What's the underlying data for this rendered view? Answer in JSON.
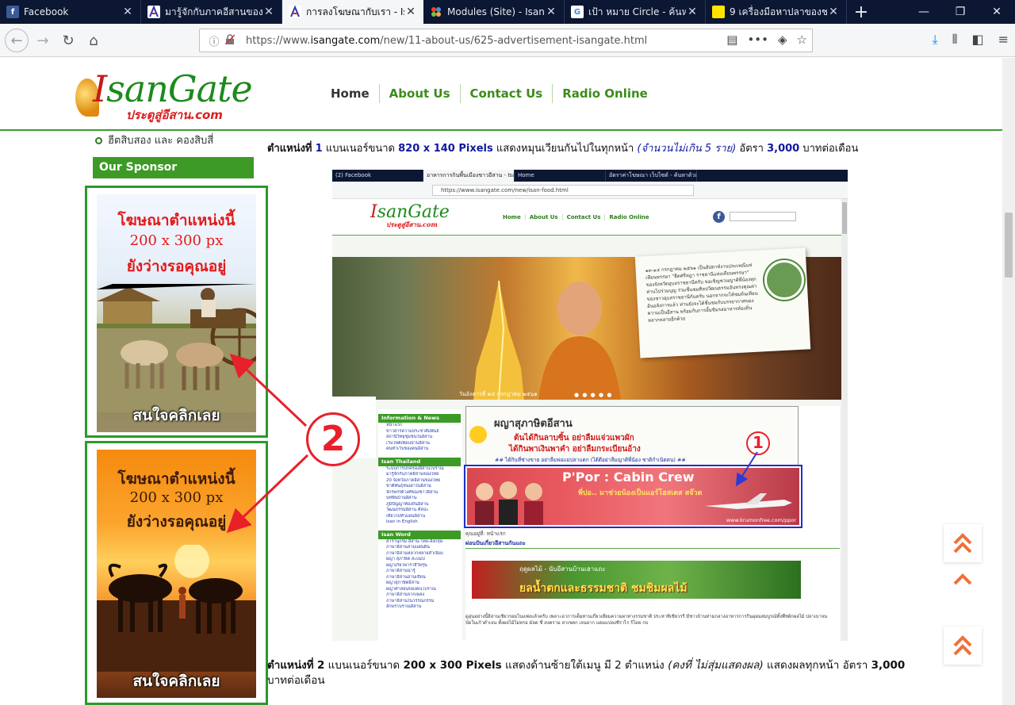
{
  "browser": {
    "tabs": [
      {
        "label": "Facebook",
        "icon": "facebook-icon",
        "active": false
      },
      {
        "label": "มารู้จักกับภาคอีสานของไทย",
        "icon": "isangate-icon",
        "active": false
      },
      {
        "label": "การลงโฆษณากับเรา - IsanGate",
        "icon": "isangate-icon",
        "active": true
      },
      {
        "label": "Modules (Site) - IsanGate",
        "icon": "joomla-icon",
        "active": false
      },
      {
        "label": "เป้า หมาย Circle - ค้นหาด้วย Google",
        "icon": "google-icon",
        "active": false
      },
      {
        "label": "9 เครื่องมือหาปลาของชาวอีสาน",
        "icon": "yellow-square-icon",
        "active": false
      }
    ],
    "url_prefix": "https://www.",
    "url_domain": "isangate.com",
    "url_path": "/new/11-about-us/625-advertisement-isangate.html",
    "icons": {
      "back": "←",
      "forward": "→",
      "reload": "↻",
      "home": "⌂",
      "info": "ⓘ",
      "reader": "▤",
      "more": "•••",
      "pocket": "◈",
      "star": "☆",
      "download": "⤓",
      "library": "⫴",
      "sidebar": "◧",
      "menu": "≡",
      "new_tab": "+",
      "minimize": "—",
      "restore": "❐",
      "close": "✕"
    }
  },
  "site": {
    "logo_main_1": "I",
    "logo_main_2": "san",
    "logo_main_3": "Gate",
    "logo_sub": "ประตูสู่อีสาน.com",
    "menu": [
      {
        "label": "Home"
      },
      {
        "label": "About Us"
      },
      {
        "label": "Contact Us"
      },
      {
        "label": "Radio Online"
      }
    ]
  },
  "sidebar": {
    "link": "ฮีตสิบสอง และ คองสิบสี่",
    "sponsor_heading": "Our Sponsor",
    "ads": [
      {
        "line1": "โฆษณาตำแหน่งนี้",
        "line2": "200 x 300 px",
        "line3": "ยังว่างรอคุณอยู่",
        "cta": "สนใจคลิกเลย"
      },
      {
        "line1": "โฆษณาตำแหน่งนี้",
        "line2": "200 x 300 px",
        "line3": "ยังว่างรอคุณอยู่",
        "cta": "สนใจคลิกเลย"
      }
    ]
  },
  "content": {
    "pos1": {
      "a": "ตำแหน่งที่",
      "n": "1",
      "b": "แบนเนอร์ขนาด",
      "size": "820 x 140 Pixels",
      "c": "แสดงหมุนเวียนกันไปในทุกหน้า",
      "note": "(จำนวนไม่เกิน 5 ราย)",
      "d": "อัตรา",
      "price": "3,000",
      "e": "บาทต่อเดือน"
    },
    "pos2": {
      "a": "ตำแหน่งที่",
      "n": "2",
      "b": "แบนเนอร์ขนาด",
      "size": "200 x 300 Pixels",
      "c": "แสดงด้านซ้ายใต้เมนู มี 2 ตำแหน่ง",
      "note": "(คงที่ ไม่สุ่มแสดงผล)",
      "d": "แสดงผลทุกหน้า อัตรา",
      "price": "3,000",
      "e": "บาทต่อเดือน"
    },
    "callout1": "1",
    "callout2": "2"
  },
  "inner": {
    "tabs": [
      "(2) Facebook",
      "อาหารการกินพื้นเมืองชาวอีสาน - IsanGate",
      "Home",
      "อัตราค่าโฆษณา เว็บไซต์ - ค้นหาด้วย Google"
    ],
    "url": "https://www.isangate.com/new/isan-food.html",
    "logo_1": "I",
    "logo_2": "sanGate",
    "logo_sub": "ประตูสู่อีสาน.com",
    "menu": [
      "Home",
      "About Us",
      "Contact Us",
      "Radio Online"
    ],
    "note": "๑๓-๑๔ กรกฎาคม ๒๕๖๑ เป็นสัปดาห์งานประเพณีแห่เทียนพรรษา \"ฮีตศรีหฎา ราชธานีแห่งเทียนพรรษา\" ของจังหวัดอุบลราชธานีครับ ขอเชิญชวนญาติพี่น้องทุกท่านไปร่วมบุญ ร่วมชื่นชมศิลปวัฒนธรรมอันทรงคุณค่าของชาวอุบลราชธานีกันครับ นอกจากจะได้ชมต้นเทียนอันอลังการแล้ว ท่านยังจะได้ชื่นชมกับบรรยากาศของความเป็นอีสาน พร้อมกับการลิ้มชิมรสอาหารท้องถิ่นหลากหลายอีกด้วย",
    "date": "วันอังคารที่ ๑๔ กรกฎาคม ๒๕๖๑",
    "dots": "● ● ● ● ●",
    "left_heads": [
      "Information & News",
      "Isan Thailand",
      "Isan Word"
    ],
    "left_items_1": [
      "หน้าแรก",
      "ข่าวสารความประชาสัมพันธ์",
      "สถานีวิทยุชุมชนในอีสาน",
      "เว็บไซต์เพื่อนบ้านอีสาน",
      "คนทำเว็บของคนอีสาน"
    ],
    "left_items_2": [
      "ระบบการปกครองอีสานโบราณ",
      "มารู้จักกับภาคอีสานของไทย",
      "20 จังหวัดภาคอีสานของไทย",
      "ชาติพันธุ์ชนเผ่าในอีสาน",
      "จักรพรรดิวงศ์ของชาวอีสาน",
      "บทพื้นบ้านอีสาน",
      "ภูมิปัญญาท้องถิ่นอีสาน",
      "วัฒนธรรมอีสาน ศิลปะ",
      "เที่ยวไปทั่วแดนอีสาน",
      "Isan in English"
    ],
    "left_items_3": [
      "สารานุกรม อีสาน-ไทย-อังกฤษ",
      "ภาษาอีสานสามแผ่นดิน",
      "ภาษาอีสานหลากหลายสำเนียง",
      "ผญา สุภาษิต สะแมป",
      "ผญาเกี้ยวพาราสีวัยรุ่น",
      "ภาษาอีสานน่ารู้",
      "ภาษาอีสานอ่านเขียน",
      "ผญาสุภาษิตอีสาน",
      "ผญาคำสอนของคนโบราณ",
      "ภาษาอีสานจากเพลง",
      "ภาษาอีสานในวรรณกรรม",
      "อักษรโบราณอีสาน"
    ],
    "proverb_title": "ผญาสุภาษิตอีสาน",
    "proverb_l1": "ต้นได้กินลาบซิ้น อย่าลืมแจ่วแพวผัก",
    "proverb_l2": "ได้กินพาเงินพาคำ อย่าลืมกระเบียนอ้าง",
    "proverb_l3": "## ได้กินที่ช่างขาย อย่าลืมพ่อแม่ปลาแดก (ได้ดีอย่าลืมญาติพี่น้อง ชาติกำเนิดตน) ##",
    "cabin_title": "P'Por : Cabin Crew",
    "cabin_sub": "พี่ปอ.. มาช่วยน้องเป็นแอร์โฮสเตส สจ๊วต",
    "cabin_url": "www.krumonfree.com/ppor",
    "caption": "คุณอยู่ที่: หน้าแรก",
    "section": "ผ่อนปันเกี่ยวอีสานกันแถะ",
    "fruit_t0": "ฤดูผลไม้ - นับอีสานบ้านเฮาแถะ",
    "fruit_t": "ยลน้ำตกและธรรมชาติ ชมชิมผลไม้",
    "para": "ดูอุ่นอย่างนี้อีสานเชียวรอมไนแพ่งแล้วครับ เพลาะอาการเต็มทานเกี่ยวเยี่ยมความผาทางรรมชาติ ประหาทีเชียวรรี มีชาวบ้านท่ามกลางอาหารการกินอุดมสมบูรณ์ทั้งพืชผักผลไม้ ปลาเบาจนบัดในเก้าตำเจน ทั้งผลไม้ไม่หรอ มัลด ชี่ สงคราม สาเขตก เจนยาก แดมแปลงชีราไร ร์โดย กบ"
  }
}
